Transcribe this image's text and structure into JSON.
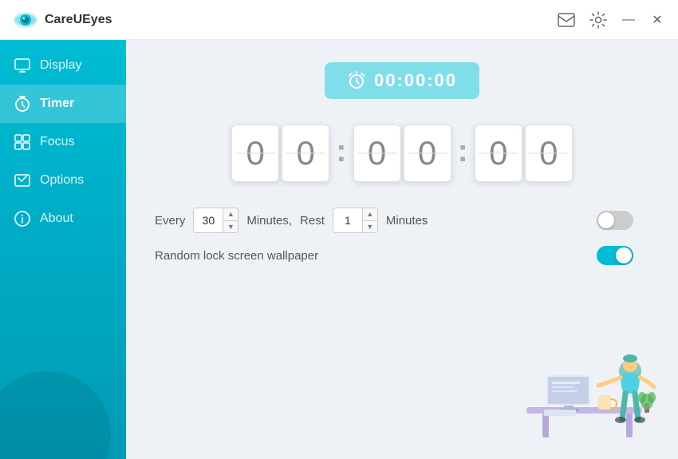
{
  "app": {
    "title": "CareUEyes"
  },
  "titlebar": {
    "email_icon": "✉",
    "settings_icon": "⚙",
    "minimize_label": "—",
    "close_label": "✕"
  },
  "sidebar": {
    "items": [
      {
        "id": "display",
        "label": "Display",
        "active": false
      },
      {
        "id": "timer",
        "label": "Timer",
        "active": true
      },
      {
        "id": "focus",
        "label": "Focus",
        "active": false
      },
      {
        "id": "options",
        "label": "Options",
        "active": false
      },
      {
        "id": "about",
        "label": "About",
        "active": false
      }
    ]
  },
  "timer": {
    "badge_time": "00:00:00",
    "digits": {
      "h1": "0",
      "h2": "0",
      "m1": "0",
      "m2": "0",
      "s1": "0",
      "s2": "0"
    },
    "every_label": "Every",
    "every_value": "30",
    "minutes_label": "Minutes,",
    "rest_label": "Rest",
    "rest_value": "1",
    "rest_minutes_label": "Minutes",
    "wallpaper_label": "Random lock screen wallpaper",
    "timer_toggle_state": "off",
    "wallpaper_toggle_state": "on"
  }
}
